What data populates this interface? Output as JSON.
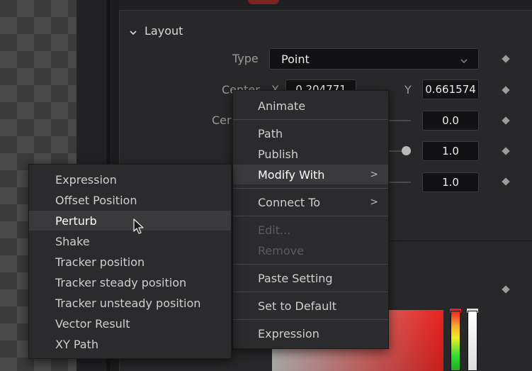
{
  "section": {
    "title": "Layout"
  },
  "rows": {
    "type_label": "Type",
    "type_value": "Point",
    "center_label": "Center",
    "center_x_label": "X",
    "center_x_value": "0.204771",
    "center_y_label": "Y",
    "center_y_value": "0.661574",
    "row3_label": "Cer",
    "row3_value": "0.0",
    "row4_value": "1.0",
    "row5_value": "1.0"
  },
  "context_menu": {
    "items": [
      {
        "label": "Animate",
        "state": "normal"
      },
      {
        "label": "Path",
        "state": "normal"
      },
      {
        "label": "Publish",
        "state": "normal"
      },
      {
        "label": "Modify With",
        "state": "highlighted",
        "submenu": true
      },
      {
        "label": "Connect To",
        "state": "normal",
        "submenu": true
      },
      {
        "label": "Edit...",
        "state": "disabled"
      },
      {
        "label": "Remove",
        "state": "disabled"
      },
      {
        "label": "Paste Setting",
        "state": "normal"
      },
      {
        "label": "Set to Default",
        "state": "normal"
      },
      {
        "label": "Expression",
        "state": "normal"
      }
    ],
    "submenu_arrow": ">"
  },
  "modify_with_menu": {
    "items": [
      {
        "label": "Expression",
        "state": "normal"
      },
      {
        "label": "Offset Position",
        "state": "normal"
      },
      {
        "label": "Perturb",
        "state": "hover"
      },
      {
        "label": "Shake",
        "state": "normal"
      },
      {
        "label": "Tracker position",
        "state": "normal"
      },
      {
        "label": "Tracker steady position",
        "state": "normal"
      },
      {
        "label": "Tracker unsteady position",
        "state": "normal"
      },
      {
        "label": "Vector Result",
        "state": "normal"
      },
      {
        "label": "XY Path",
        "state": "normal"
      }
    ]
  },
  "icons": {
    "section_toggle": "chevron-down-icon",
    "type_dropdown": "chevron-down-icon",
    "keyframe": "diamond-keyframe-icon",
    "submenu": "chevron-right-icon",
    "cursor": "arrow-cursor-icon"
  },
  "colors": {
    "panel_bg": "#28282a",
    "field_bg": "#121214",
    "menu_bg": "#2b2b2e",
    "menu_highlight": "#3a3a3d",
    "color_swatch_red": "#e9231f"
  }
}
